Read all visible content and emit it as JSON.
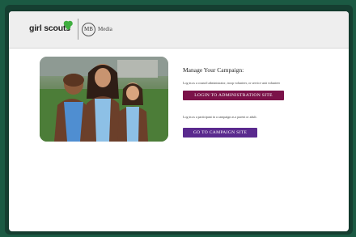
{
  "header": {
    "brand": "girl scouts",
    "partner_mark": "MB",
    "partner_label": "Media"
  },
  "main": {
    "hero_image_alt": "",
    "title": "Manage Your Campaign:",
    "admin_description": "Log in as a council administrator, troop volunteer, or service unit volunteer",
    "admin_button": "LOGIN TO ADMINISTRATION SITE",
    "participant_description": "Log in as a participant in a campaign as a parent or adult.",
    "campaign_button": "GO TO CAMPAIGN SITE"
  },
  "colors": {
    "frame": "#1b5a43",
    "admin_button": "#7b1249",
    "campaign_button": "#5a2a8e",
    "trefoil": "#3fae3f"
  },
  "icons": {
    "trefoil": "trefoil-icon",
    "partner": "mb-media-logo"
  }
}
